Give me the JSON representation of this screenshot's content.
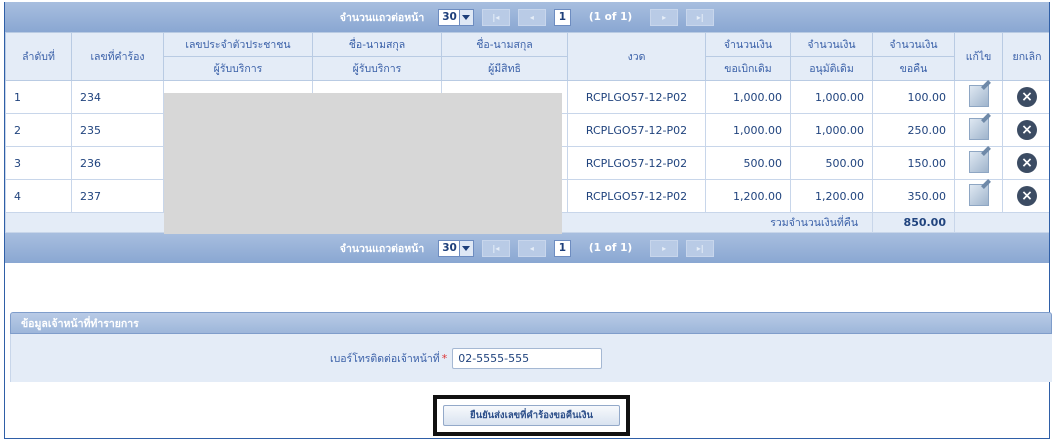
{
  "pager_top": {
    "rows_label": "จำนวนแถวต่อหน้า",
    "rows_value": "30",
    "page": "1",
    "of_text": "(1 of 1)"
  },
  "pager_bottom": {
    "rows_label": "จำนวนแถวต่อหน้า",
    "rows_value": "30",
    "page": "1",
    "of_text": "(1 of 1)"
  },
  "table": {
    "headers": {
      "no": "ลำดับที่",
      "request_no": "เลขที่คำร้อง",
      "id_card": [
        "เลขประจำตัวประชาชน",
        "ผู้รับบริการ"
      ],
      "name_service": [
        "ชื่อ-นามสกุล",
        "ผู้รับบริการ"
      ],
      "name_right": [
        "ชื่อ-นามสกุล",
        "ผู้มีสิทธิ"
      ],
      "period": "งวด",
      "amount_claim": [
        "จำนวนเงิน",
        "ขอเบิกเดิม"
      ],
      "amount_approved": [
        "จำนวนเงิน",
        "อนุมัติเดิม"
      ],
      "amount_refund": [
        "จำนวนเงิน",
        "ขอคืน"
      ],
      "edit": "แก้ไข",
      "cancel": "ยกเลิก"
    },
    "rows": [
      {
        "no": "1",
        "request_no": "234",
        "period": "RCPLGO57-12-P02",
        "claim": "1,000.00",
        "approved": "1,000.00",
        "refund": "100.00"
      },
      {
        "no": "2",
        "request_no": "235",
        "period": "RCPLGO57-12-P02",
        "claim": "1,000.00",
        "approved": "1,000.00",
        "refund": "250.00"
      },
      {
        "no": "3",
        "request_no": "236",
        "period": "RCPLGO57-12-P02",
        "claim": "500.00",
        "approved": "500.00",
        "refund": "150.00"
      },
      {
        "no": "4",
        "request_no": "237",
        "period": "RCPLGO57-12-P02",
        "claim": "1,200.00",
        "approved": "1,200.00",
        "refund": "350.00"
      }
    ],
    "total_label": "รวมจำนวนเงินที่คืน",
    "total_value": "850.00"
  },
  "officer_section": {
    "title": "ข้อมูลเจ้าหน้าที่ทำรายการ",
    "phone_label": "เบอร์โทรติดต่อเจ้าหน้าที่",
    "required_mark": "*",
    "phone_value": "02-5555-555"
  },
  "confirm_button": "ยืนยันส่งเลขที่คำร้องขอคืนเงิน",
  "icons": {
    "edit": "edit-icon",
    "cancel": "cancel-icon",
    "first": "first-page-icon",
    "prev": "prev-page-icon",
    "next": "next-page-icon",
    "last": "last-page-icon"
  },
  "colors": {
    "header_bar": "#8aa7d2",
    "table_header": "#e4ecf7",
    "text": "#21447e"
  }
}
